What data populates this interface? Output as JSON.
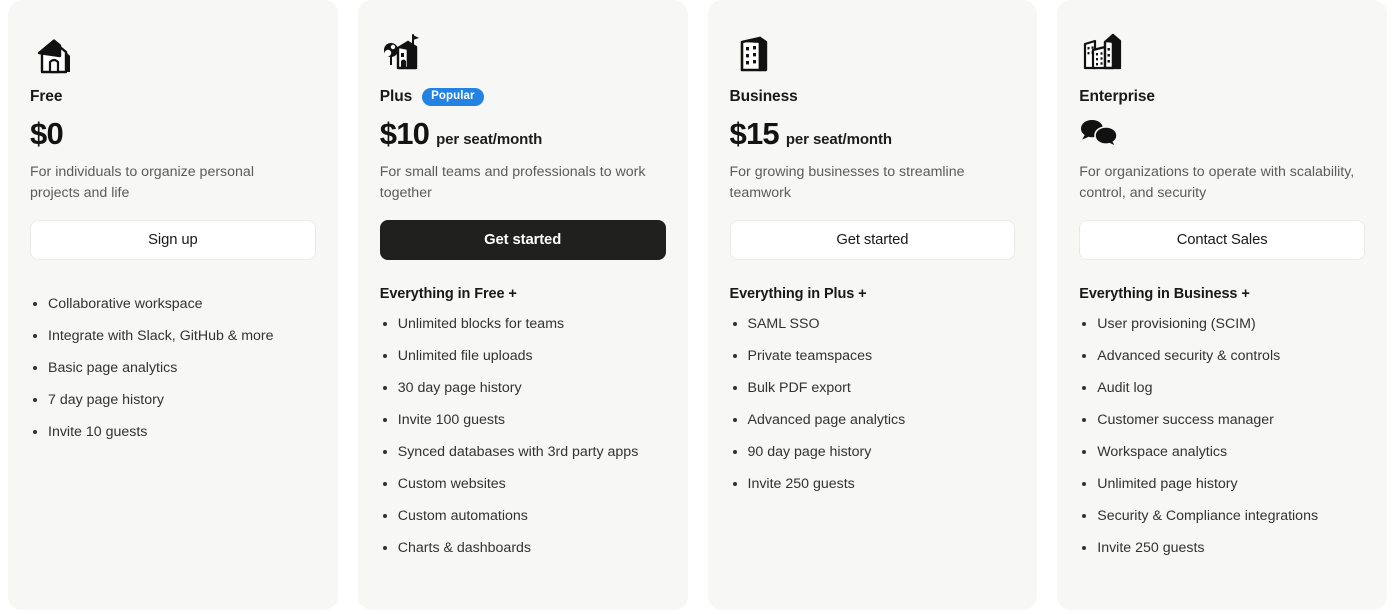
{
  "plans": [
    {
      "id": "free",
      "icon": "house-icon",
      "name": "Free",
      "badge": null,
      "price": "$0",
      "price_unit": "",
      "description": "For individuals to organize personal projects and life",
      "cta_label": "Sign up",
      "cta_style": "light",
      "features_heading": "",
      "features": [
        "Collaborative workspace",
        "Integrate with Slack, GitHub & more",
        "Basic page analytics",
        "7 day page history",
        "Invite 10 guests"
      ]
    },
    {
      "id": "plus",
      "icon": "house-with-tree-icon",
      "name": "Plus",
      "badge": "Popular",
      "price": "$10",
      "price_unit": "per seat/month",
      "description": "For small teams and professionals to work together",
      "cta_label": "Get started",
      "cta_style": "dark",
      "features_heading": "Everything in Free +",
      "features": [
        "Unlimited blocks for teams",
        "Unlimited file uploads",
        "30 day page history",
        "Invite 100 guests",
        "Synced databases with 3rd party apps",
        "Custom websites",
        "Custom automations",
        "Charts & dashboards"
      ]
    },
    {
      "id": "business",
      "icon": "office-building-icon",
      "name": "Business",
      "badge": null,
      "price": "$15",
      "price_unit": "per seat/month",
      "description": "For growing businesses to streamline teamwork",
      "cta_label": "Get started",
      "cta_style": "light",
      "features_heading": "Everything in Plus +",
      "features": [
        "SAML SSO",
        "Private teamspaces",
        "Bulk PDF export",
        "Advanced page analytics",
        "90 day page history",
        "Invite 250 guests"
      ]
    },
    {
      "id": "enterprise",
      "icon": "city-buildings-icon",
      "name": "Enterprise",
      "badge": null,
      "price": "",
      "price_unit": "",
      "price_icon": "speech-bubbles-icon",
      "description": "For organizations to operate with scalability, control, and security",
      "cta_label": "Contact Sales",
      "cta_style": "light",
      "features_heading": "Everything in Business +",
      "features": [
        "User provisioning (SCIM)",
        "Advanced security & controls",
        "Audit log",
        "Customer success manager",
        "Workspace analytics",
        "Unlimited page history",
        "Security & Compliance integrations",
        "Invite 250 guests"
      ]
    }
  ],
  "colors": {
    "card_background": "#f7f7f5",
    "page_background": "#ffffff",
    "badge_blue": "#2383e2",
    "dark_button": "#20201f",
    "text_primary": "#191918",
    "text_secondary": "#5b5b58"
  }
}
